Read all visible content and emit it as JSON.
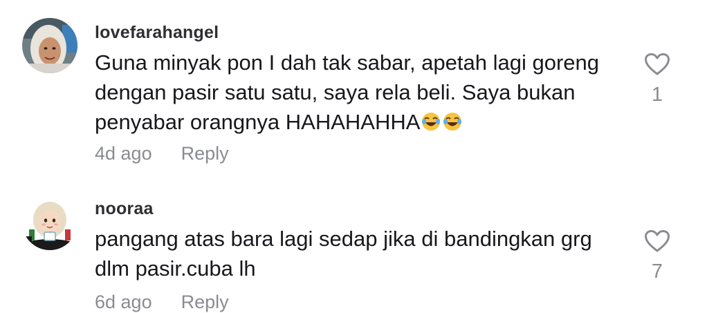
{
  "comments": [
    {
      "username": "lovefarahangel",
      "text": "Guna minyak pon I dah tak sabar, apetah lagi goreng dengan pasir satu satu, saya rela beli. Saya bukan penyabar orangnya HAHAHAHHA",
      "emojis": [
        "😂",
        "😂"
      ],
      "time": "4d ago",
      "reply_label": "Reply",
      "likes": "1",
      "avatar_icon": "user-photo-avatar",
      "like_icon": "heart-outline-icon"
    },
    {
      "username": "nooraa",
      "text": "pangang atas bara lagi sedap jika di bandingkan grg dlm pasir.cuba lh",
      "time": "6d ago",
      "reply_label": "Reply",
      "likes": "7",
      "avatar_icon": "cartoon-hijab-avatar",
      "like_icon": "heart-outline-icon"
    }
  ],
  "colors": {
    "text": "#17171c",
    "username": "#2f2f33",
    "muted": "#8a8b91",
    "background": "#ffffff"
  }
}
